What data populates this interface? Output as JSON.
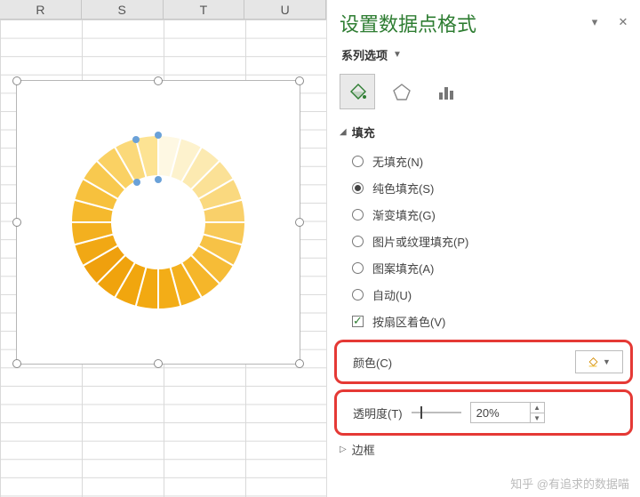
{
  "columns": [
    "R",
    "S",
    "T",
    "U"
  ],
  "pane": {
    "title": "设置数据点格式",
    "dropdown_label": "系列选项",
    "tab_icons": [
      "fill-icon",
      "effects-icon",
      "chart-icon"
    ],
    "section_fill": "填充",
    "options": {
      "none": "无填充(N)",
      "solid": "纯色填充(S)",
      "gradient": "渐变填充(G)",
      "picture": "图片或纹理填充(P)",
      "pattern": "图案填充(A)",
      "auto": "自动(U)",
      "varycolor": "按扇区着色(V)"
    },
    "color_label": "颜色(C)",
    "transparency_label": "透明度(T)",
    "transparency_value": "20%",
    "section_border": "边框"
  },
  "watermark": "知乎 @有追求的数据喵",
  "chart_data": {
    "type": "doughnut",
    "segments": 24,
    "equal_value_per_segment": 1,
    "colors_note": "one segment highlighted/selected; gradient of yellow hues"
  }
}
